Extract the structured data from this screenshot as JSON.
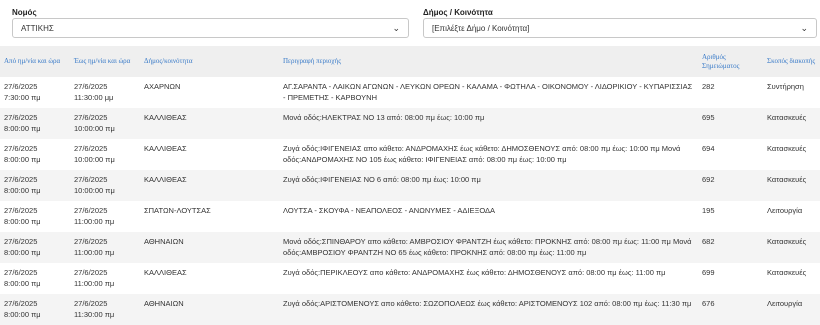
{
  "filters": {
    "prefecture_label": "Νομός",
    "prefecture_value": "ΑΤΤΙΚΗΣ",
    "municipality_label": "Δήμος / Κοινότητα",
    "municipality_value": "[Επιλέξτε Δήμο / Κοινότητα]"
  },
  "table": {
    "headers": [
      "Από ημ/νία και ώρα",
      "Έως ημ/νία και ώρα",
      "Δήμος/κοινότητα",
      "Περιγραφή περιοχής",
      "Αριθμός Σημειώματος",
      "Σκοπός διακοπής"
    ],
    "rows": [
      {
        "from_date": "27/6/2025",
        "from_time": "7:30:00 πμ",
        "to_date": "27/6/2025",
        "to_time": "11:30:00 μμ",
        "municipality": "ΑΧΑΡΝΩΝ",
        "description": "ΑΓ.ΣΑΡΑΝΤΑ - ΛΑΙΚΩΝ ΑΓΩΝΩΝ - ΛΕΥΚΩΝ ΟΡΕΩΝ - ΚΑΛΑΜΑ - ΦΩΤΗΛΑ - ΟΙΚΟΝΟΜΟΥ - ΛΙΔΟΡΙΚΙΟΥ - ΚΥΠΑΡΙΣΣΙΑΣ - ΠΡΕΜΕΤΗΣ - ΚΑΡΒΟΥΝΗ",
        "number": "282",
        "purpose": "Συντήρηση"
      },
      {
        "from_date": "27/6/2025",
        "from_time": "8:00:00 πμ",
        "to_date": "27/6/2025",
        "to_time": "10:00:00 πμ",
        "municipality": "ΚΑΛΛΙΘΕΑΣ",
        "description": "Μονά οδός:ΗΛΕΚΤΡΑΣ ΝΟ 13 από: 08:00 πμ έως: 10:00 πμ",
        "number": "695",
        "purpose": "Κατασκευές"
      },
      {
        "from_date": "27/6/2025",
        "from_time": "8:00:00 πμ",
        "to_date": "27/6/2025",
        "to_time": "10:00:00 πμ",
        "municipality": "ΚΑΛΛΙΘΕΑΣ",
        "description": "Ζυγά οδός:ΙΦΙΓΕΝΕΙΑΣ απο κάθετο: ΑΝΔΡΟΜΑΧΗΣ έως κάθετο: ΔΗΜΟΣΘΕΝΟΥΣ από: 08:00 πμ έως: 10:00 πμ Μονά οδός:ΑΝΔΡΟΜΑΧΗΣ ΝΟ 105 έως κάθετο: ΙΦΙΓΕΝΕΙΑΣ από: 08:00 πμ έως: 10:00 πμ",
        "number": "694",
        "purpose": "Κατασκευές"
      },
      {
        "from_date": "27/6/2025",
        "from_time": "8:00:00 πμ",
        "to_date": "27/6/2025",
        "to_time": "10:00:00 πμ",
        "municipality": "ΚΑΛΛΙΘΕΑΣ",
        "description": "Ζυγά οδός:ΙΦΙΓΕΝΕΙΑΣ ΝΟ 6 από: 08:00 πμ έως: 10:00 πμ",
        "number": "692",
        "purpose": "Κατασκευές"
      },
      {
        "from_date": "27/6/2025",
        "from_time": "8:00:00 πμ",
        "to_date": "27/6/2025",
        "to_time": "11:00:00 πμ",
        "municipality": "ΣΠΑΤΩΝ-ΛΟΥΤΣΑΣ",
        "description": "ΛΟΥΤΣΑ - ΣΚΟΥΦΑ - ΝΕΑΠΟΛΕΟΣ - ΑΝΩΝΥΜΕΣ - ΑΔΙΕΞΟΔΑ",
        "number": "195",
        "purpose": "Λειτουργία"
      },
      {
        "from_date": "27/6/2025",
        "from_time": "8:00:00 πμ",
        "to_date": "27/6/2025",
        "to_time": "11:00:00 πμ",
        "municipality": "ΑΘΗΝΑΙΩΝ",
        "description": "Μονά οδός:ΣΠΙΝΘΑΡΟΥ απο κάθετο: ΑΜΒΡΟΣΙΟΥ ΦΡΑΝΤΖΗ έως κάθετο: ΠΡΟΚΝΗΣ από: 08:00 πμ έως: 11:00 πμ Μονά οδός:ΑΜΒΡΟΣΙΟΥ ΦΡΑΝΤΖΗ ΝΟ 65 έως κάθετο: ΠΡΟΚΝΗΣ από: 08:00 πμ έως: 11:00 πμ",
        "number": "682",
        "purpose": "Κατασκευές"
      },
      {
        "from_date": "27/6/2025",
        "from_time": "8:00:00 πμ",
        "to_date": "27/6/2025",
        "to_time": "11:00:00 πμ",
        "municipality": "ΚΑΛΛΙΘΕΑΣ",
        "description": "Ζυγά οδός:ΠΕΡΙΚΛΕΟΥΣ απο κάθετο: ΑΝΔΡΟΜΑΧΗΣ έως κάθετο: ΔΗΜΟΣΘΕΝΟΥΣ από: 08:00 πμ έως: 11:00 πμ",
        "number": "699",
        "purpose": "Κατασκευές"
      },
      {
        "from_date": "27/6/2025",
        "from_time": "8:00:00 πμ",
        "to_date": "27/6/2025",
        "to_time": "11:30:00 πμ",
        "municipality": "ΑΘΗΝΑΙΩΝ",
        "description": "Ζυγά οδός:ΑΡΙΣΤΟΜΕΝΟΥΣ απο κάθετο: ΣΩΖΟΠΟΛΕΩΣ έως κάθετο: ΑΡΙΣΤΟΜΕΝΟΥΣ 102 από: 08:00 πμ έως: 11:30 πμ",
        "number": "676",
        "purpose": "Λειτουργία"
      }
    ]
  }
}
